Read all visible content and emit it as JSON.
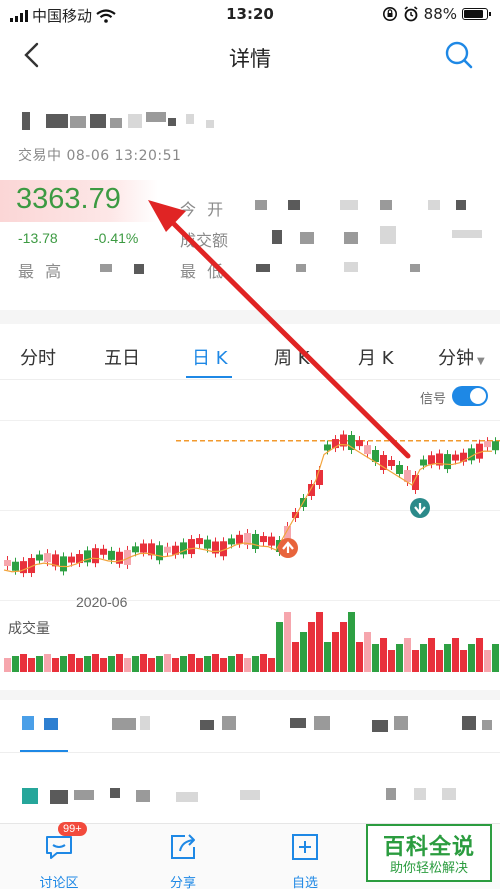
{
  "status_bar": {
    "carrier": "中国移动",
    "time": "13:20",
    "battery": "88%",
    "battery_level": 0.88
  },
  "nav": {
    "title": "详情"
  },
  "stock": {
    "trade_status": "交易中 08-06 13:20:51",
    "price": "3363.79",
    "change": "-13.78",
    "change_pct": "-0.41%",
    "labels": {
      "open": "今 开",
      "volume": "成交额",
      "high": "最 高",
      "low": "最 低"
    }
  },
  "period_tabs": [
    {
      "label": "分时"
    },
    {
      "label": "五日"
    },
    {
      "label": "日 K",
      "active": true
    },
    {
      "label": "周 K"
    },
    {
      "label": "月 K"
    },
    {
      "label": "分钟"
    }
  ],
  "chart": {
    "signal_label": "信号",
    "signal_on": true,
    "date_label": "2020-06",
    "volume_label": "成交量"
  },
  "toolbar": [
    {
      "label": "讨论区",
      "icon": "chat-bubble-icon",
      "badge": "99+"
    },
    {
      "label": "分享",
      "icon": "share-icon"
    },
    {
      "label": "自选",
      "icon": "add-square-icon"
    }
  ],
  "watermark": {
    "line1": "百科全说",
    "line2": "助你轻松解决"
  },
  "colors": {
    "accent": "#1e88e5",
    "up": "#e8313b",
    "down": "#2ea043",
    "price_green": "#3c9a42",
    "arrow": "#e02424"
  }
}
